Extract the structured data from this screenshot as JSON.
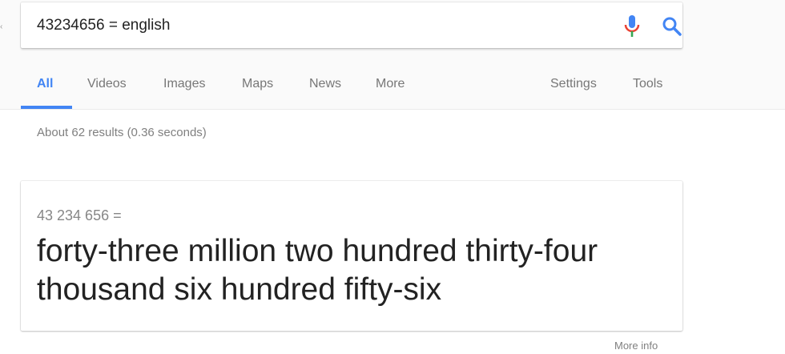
{
  "search": {
    "query": "43234656 = english"
  },
  "tabs": [
    {
      "label": "All",
      "active": true
    },
    {
      "label": "Videos"
    },
    {
      "label": "Images"
    },
    {
      "label": "Maps"
    },
    {
      "label": "News"
    },
    {
      "label": "More"
    },
    {
      "label": "Settings"
    },
    {
      "label": "Tools"
    }
  ],
  "results": {
    "stats": "About 62 results (0.36 seconds)"
  },
  "answer": {
    "equation": "43 234 656 =",
    "words": "forty-three million two hundred thirty-four thousand six hundred fifty-six",
    "more_info": "More info"
  },
  "colors": {
    "accent": "#4285f4",
    "mic_red": "#ea4335",
    "mic_blue": "#4285f4",
    "mic_green": "#34a853"
  },
  "icons": [
    "microphone-icon",
    "search-icon"
  ]
}
